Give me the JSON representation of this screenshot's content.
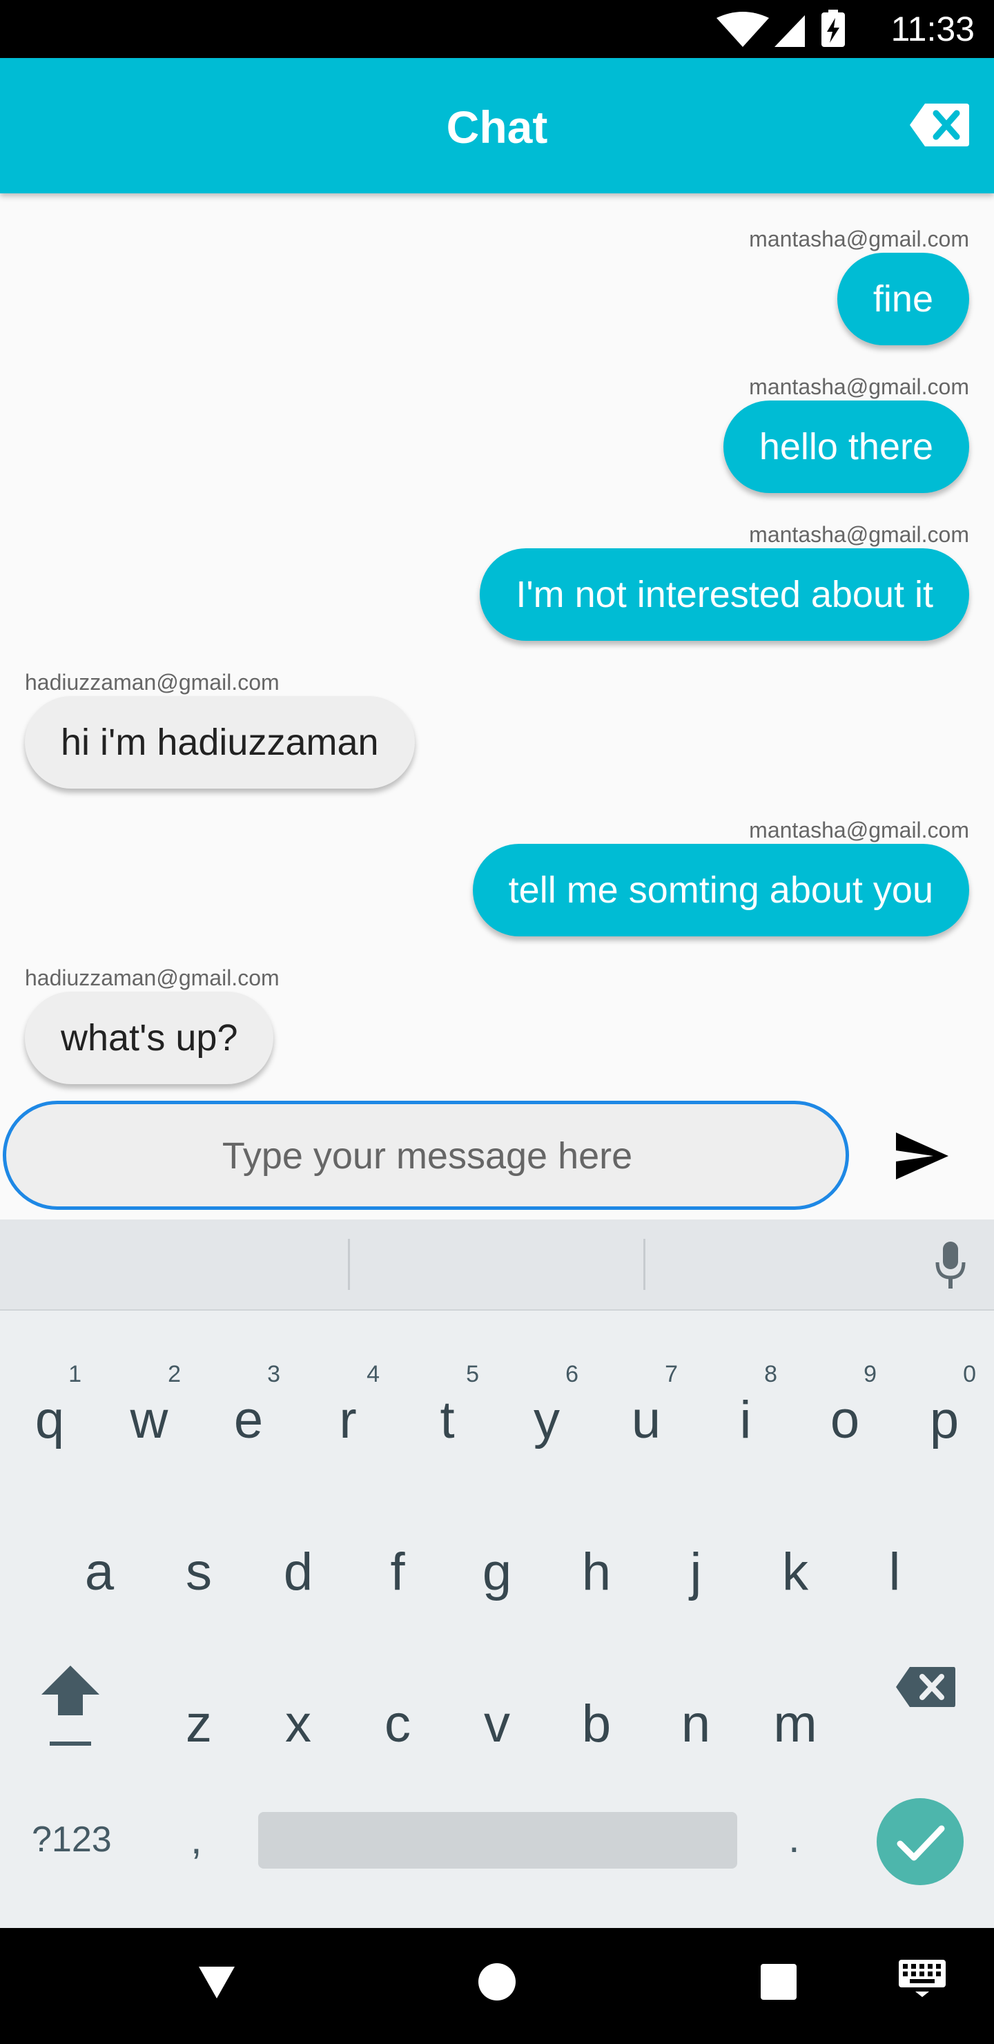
{
  "status_bar": {
    "time": "11:33"
  },
  "app_bar": {
    "title": "Chat",
    "clear_icon": "backspace-clear-icon"
  },
  "messages": [
    {
      "sender": "mantasha@gmail.com",
      "text": "fine",
      "side": "right"
    },
    {
      "sender": "mantasha@gmail.com",
      "text": "hello there",
      "side": "right"
    },
    {
      "sender": "mantasha@gmail.com",
      "text": "I'm not interested about it",
      "side": "right"
    },
    {
      "sender": "hadiuzzaman@gmail.com",
      "text": "hi i'm hadiuzzaman",
      "side": "left"
    },
    {
      "sender": "mantasha@gmail.com",
      "text": "tell me somting about you",
      "side": "right"
    },
    {
      "sender": "hadiuzzaman@gmail.com",
      "text": "what's up?",
      "side": "left"
    }
  ],
  "composer": {
    "placeholder": "Type your message here",
    "send_icon": "send-icon"
  },
  "keyboard": {
    "row1": [
      "q",
      "w",
      "e",
      "r",
      "t",
      "y",
      "u",
      "i",
      "o",
      "p"
    ],
    "row1_hints": [
      "1",
      "2",
      "3",
      "4",
      "5",
      "6",
      "7",
      "8",
      "9",
      "0"
    ],
    "row2": [
      "a",
      "s",
      "d",
      "f",
      "g",
      "h",
      "j",
      "k",
      "l"
    ],
    "row3": [
      "z",
      "x",
      "c",
      "v",
      "b",
      "n",
      "m"
    ],
    "symbols_label": "?123",
    "comma": ",",
    "period": "."
  },
  "colors": {
    "accent": "#00bcd4",
    "focus": "#1e88e5",
    "enter": "#4db6ac"
  }
}
